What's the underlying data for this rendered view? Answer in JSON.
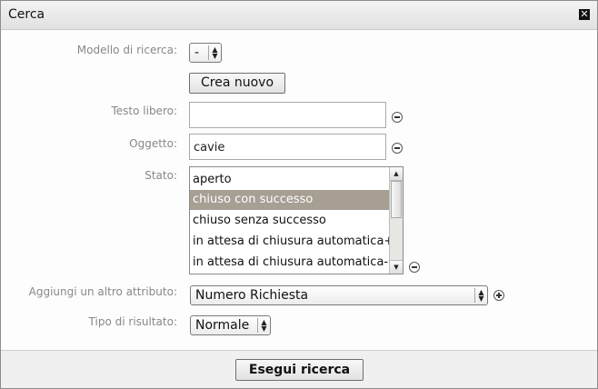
{
  "dialog": {
    "title": "Cerca",
    "close_glyph": "✕"
  },
  "form": {
    "search_model": {
      "label": "Modello di ricerca:",
      "value": "-"
    },
    "create_new_label": "Crea nuovo",
    "free_text": {
      "label": "Testo libero:",
      "value": ""
    },
    "subject": {
      "label": "Oggetto:",
      "value": "cavie"
    },
    "status": {
      "label": "Stato:",
      "options": [
        "aperto",
        "chiuso con successo",
        "chiuso senza successo",
        "in attesa di chiusura automatica+",
        "in attesa di chiusura automatica-"
      ],
      "selected_index": 1
    },
    "add_attribute": {
      "label": "Aggiungi un altro attributo:",
      "value": "Numero Richiesta"
    },
    "result_type": {
      "label": "Tipo di risultato:",
      "value": "Normale"
    }
  },
  "footer": {
    "run_search_label": "Esegui ricerca"
  },
  "icons": {
    "remove": "minus-circle-icon",
    "add": "plus-circle-icon",
    "close": "close-icon"
  },
  "colors": {
    "selected_row": "#a79e94",
    "label_text": "#888888"
  }
}
